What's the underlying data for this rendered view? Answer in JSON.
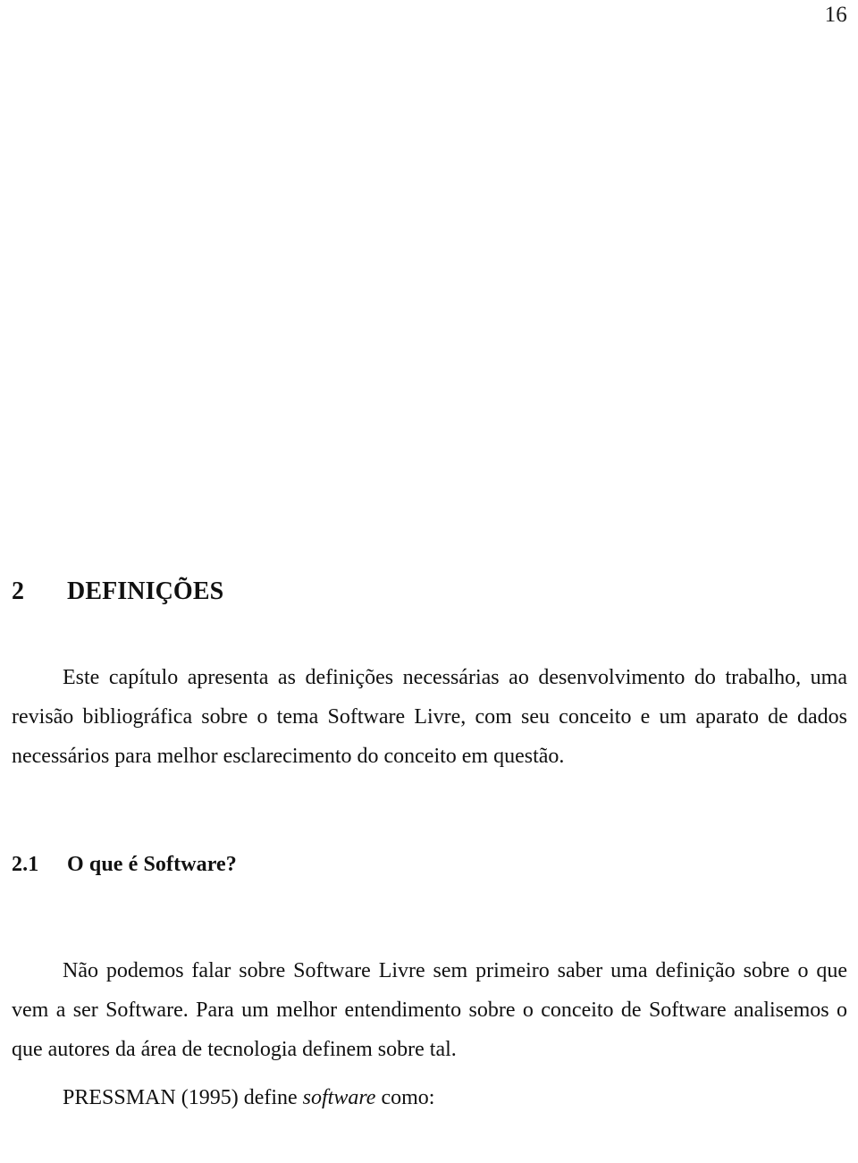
{
  "document": {
    "language": "pt-BR",
    "page_number": "16",
    "text_color": "#111111",
    "background_color": "#ffffff"
  },
  "chapter": {
    "number": "2",
    "title": "DEFINIÇÕES"
  },
  "paragraphs": {
    "intro": "Este capítulo apresenta as definições necessárias ao desenvolvimento do trabalho, uma revisão bibliográfica sobre o tema Software Livre, com seu conceito e um aparato de dados necessários para melhor esclarecimento do conceito em questão."
  },
  "section": {
    "number": "2.1",
    "title": "O que é Software?"
  },
  "section_body": {
    "paragraph_1": "Não podemos falar sobre Software Livre sem primeiro saber uma definição sobre o que vem a ser Software. Para um melhor entendimento sobre o conceito de Software analisemos o que autores da área de tecnologia definem sobre tal.",
    "citation_lead_in_before": "PRESSMAN (1995) define ",
    "citation_lead_in_italic": "software",
    "citation_lead_in_after": " como:"
  }
}
